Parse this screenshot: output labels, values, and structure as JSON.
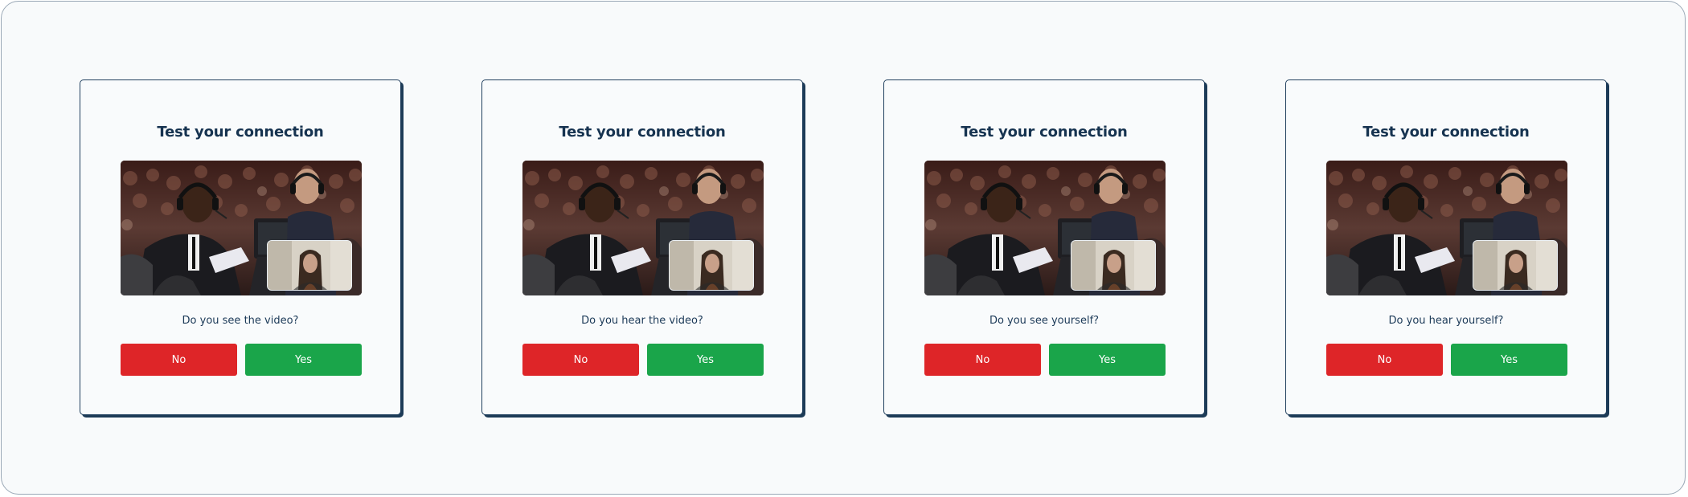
{
  "cards": [
    {
      "title": "Test your connection",
      "question": "Do you see the video?",
      "no_label": "No",
      "yes_label": "Yes"
    },
    {
      "title": "Test your connection",
      "question": "Do you hear the video?",
      "no_label": "No",
      "yes_label": "Yes"
    },
    {
      "title": "Test your connection",
      "question": "Do you see yourself?",
      "no_label": "No",
      "yes_label": "Yes"
    },
    {
      "title": "Test your connection",
      "question": "Do you hear yourself?",
      "no_label": "No",
      "yes_label": "Yes"
    }
  ],
  "colors": {
    "title": "#163350",
    "no_button": "#de2528",
    "yes_button": "#1aa54a",
    "card_border": "#21405e"
  }
}
